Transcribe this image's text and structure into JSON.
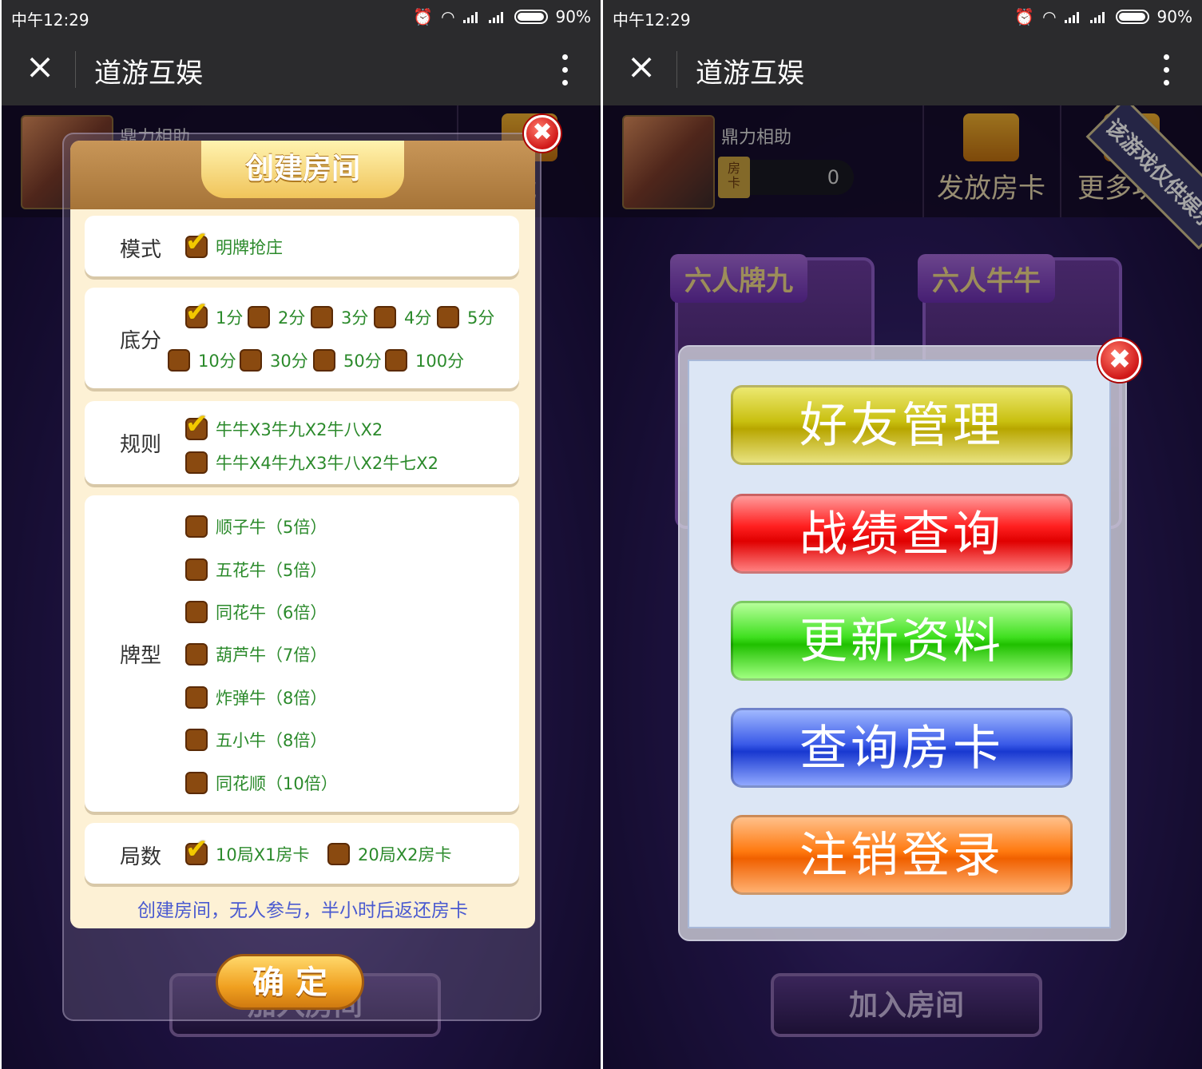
{
  "status": {
    "time": "中午12:29",
    "battery": "90%"
  },
  "nav": {
    "title": "道游互娱"
  },
  "lobby": {
    "nickname": "鼎力相助",
    "card_tag": "房\n卡",
    "card_count": "0",
    "btn_cards": "发放房卡",
    "btn_more": "更多功能",
    "btn_more_partial": "功能",
    "game1": "六人牌九",
    "game2": "六人牛牛",
    "corner_banner": "该游戏仅供娱乐",
    "join": "加入房间"
  },
  "create_room": {
    "title": "创建房间",
    "mode": {
      "label": "模式",
      "options": [
        {
          "text": "明牌抢庄",
          "checked": true
        }
      ]
    },
    "base": {
      "label": "底分",
      "options": [
        {
          "text": "1分",
          "checked": true
        },
        {
          "text": "2分",
          "checked": false
        },
        {
          "text": "3分",
          "checked": false
        },
        {
          "text": "4分",
          "checked": false
        },
        {
          "text": "5分",
          "checked": false
        },
        {
          "text": "10分",
          "checked": false
        },
        {
          "text": "30分",
          "checked": false
        },
        {
          "text": "50分",
          "checked": false
        },
        {
          "text": "100分",
          "checked": false
        }
      ]
    },
    "rules": {
      "label": "规则",
      "options": [
        {
          "text": "牛牛X3牛九X2牛八X2",
          "checked": true
        },
        {
          "text": "牛牛X4牛九X3牛八X2牛七X2",
          "checked": false
        }
      ]
    },
    "types": {
      "label": "牌型",
      "options": [
        {
          "text": "顺子牛（5倍）",
          "checked": false
        },
        {
          "text": "五花牛（5倍）",
          "checked": false
        },
        {
          "text": "同花牛（6倍）",
          "checked": false
        },
        {
          "text": "葫芦牛（7倍）",
          "checked": false
        },
        {
          "text": "炸弹牛（8倍）",
          "checked": false
        },
        {
          "text": "五小牛（8倍）",
          "checked": false
        },
        {
          "text": "同花顺（10倍）",
          "checked": false
        }
      ]
    },
    "rounds": {
      "label": "局数",
      "options": [
        {
          "text": "10局X1房卡",
          "checked": true
        },
        {
          "text": "20局X2房卡",
          "checked": false
        }
      ]
    },
    "note": "创建房间，无人参与，半小时后返还房卡",
    "confirm": "确 定"
  },
  "menu": {
    "buttons": [
      {
        "label": "好友管理",
        "color": "yellow"
      },
      {
        "label": "战绩查询",
        "color": "red"
      },
      {
        "label": "更新资料",
        "color": "green"
      },
      {
        "label": "查询房卡",
        "color": "blue"
      },
      {
        "label": "注销登录",
        "color": "orange"
      }
    ]
  }
}
